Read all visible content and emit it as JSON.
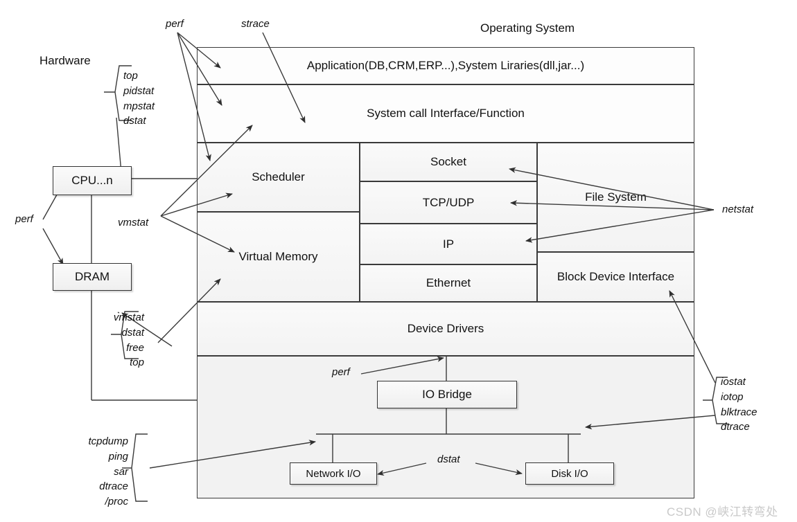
{
  "title_labels": {
    "operating_system": "Operating System",
    "hardware": "Hardware"
  },
  "os_layers": {
    "application": "Application(DB,CRM,ERP...),System Liraries(dll,jar...)",
    "syscall": "System call Interface/Function",
    "scheduler": "Scheduler",
    "virtual_memory": "Virtual Memory",
    "socket": "Socket",
    "tcp_udp": "TCP/UDP",
    "ip": "IP",
    "ethernet": "Ethernet",
    "file_system": "File System",
    "block_device_interface": "Block Device Interface",
    "device_drivers": "Device Drivers"
  },
  "hardware_boxes": {
    "cpu": "CPU...n",
    "dram": "DRAM",
    "io_bridge": "IO Bridge",
    "network_io": "Network I/O",
    "disk_io": "Disk I/O"
  },
  "tool_labels": {
    "perf_top": "perf",
    "strace": "strace",
    "cpu_tools": "top\npidstat\nmpstat\ndstat",
    "perf_left": "perf",
    "vmstat": "vmstat",
    "mem_tools": "vmstat\ndstat\nfree\ntop",
    "netstat": "netstat",
    "disk_tools": "iostat\niotop\nblktrace\ndtrace",
    "perf_iobridge": "perf",
    "net_tools": "tcpdump\nping\nsar\ndtrace\n/proc",
    "dstat_bottom": "dstat"
  },
  "watermark": "CSDN @峡江转弯处",
  "colors": {
    "stroke": "#3a3a3a",
    "box_border": "#333333",
    "text": "#141414",
    "watermark": "#c9c9c9"
  }
}
